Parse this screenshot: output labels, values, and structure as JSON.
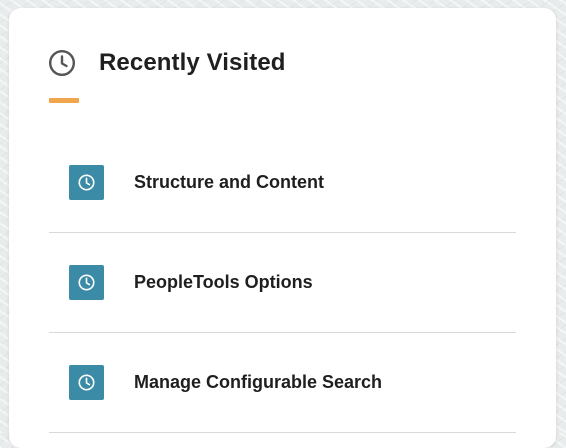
{
  "tile": {
    "title": "Recently Visited",
    "header_icon": "clock-icon",
    "accent_color": "#f0a64d",
    "items": [
      {
        "label": "Structure and Content",
        "icon": "clock-icon",
        "icon_bg": "#3c8ba6"
      },
      {
        "label": "PeopleTools Options",
        "icon": "clock-icon",
        "icon_bg": "#3c8ba6"
      },
      {
        "label": "Manage Configurable Search",
        "icon": "clock-icon",
        "icon_bg": "#3c8ba6"
      }
    ]
  }
}
